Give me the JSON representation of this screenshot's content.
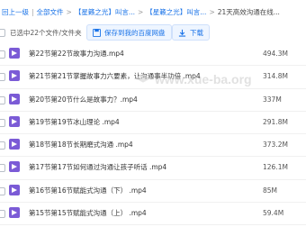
{
  "breadcrumb": {
    "back": "回上一级",
    "root": "全部文件",
    "level2": "【星籁之光】叫言...",
    "level3": "【星籁之光】叫言...",
    "current": "21天高效沟通在线..."
  },
  "toolbar": {
    "selection_text": "已选中22个文件/文件夹",
    "save_label": "保存到我的百度网盘",
    "download_label": "下载"
  },
  "files": [
    {
      "name": "第22节第22节故事力沟通.mp4",
      "size": "494.3M"
    },
    {
      "name": "第21节第21节掌握故事力六要素，让沟通事半功倍 .mp4",
      "size": "314.8M"
    },
    {
      "name": "第20节第20节什么是故事力？.mp4",
      "size": "337M"
    },
    {
      "name": "第19节第19节冰山理论 .mp4",
      "size": "291.8M"
    },
    {
      "name": "第18节第18节长期磨式沟通 .mp4",
      "size": "373.2M"
    },
    {
      "name": "第17节第17节如何通过沟通让孩子听话 .mp4",
      "size": "126.1M"
    },
    {
      "name": "第16节第16节赋能式沟通（下） .mp4",
      "size": "85M"
    },
    {
      "name": "第15节第15节赋能式沟通（上） .mp4",
      "size": "59.4M"
    }
  ],
  "watermark": "www.xue-ba.org",
  "colors": {
    "accent": "#1a73e8",
    "video_icon": "#7b5bd6"
  }
}
